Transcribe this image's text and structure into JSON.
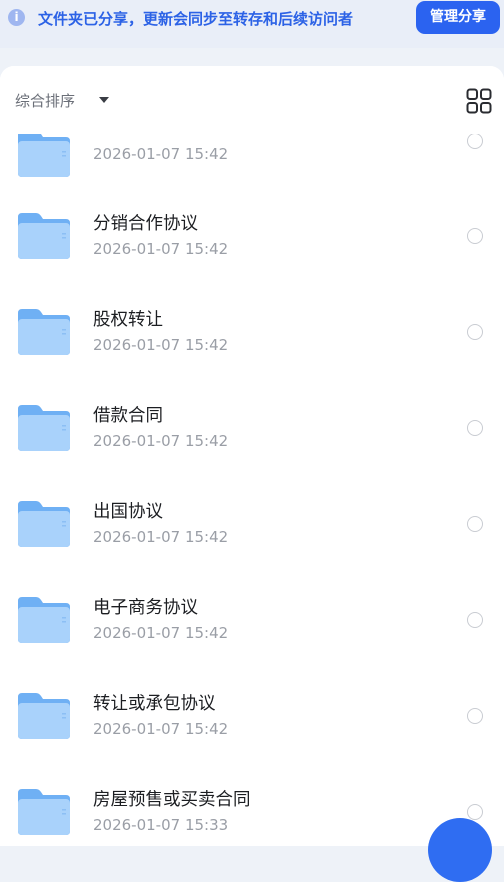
{
  "notice": {
    "icon": "info-icon",
    "text": "文件夹已分享，更新会同步至转存和后续访问者",
    "button": "管理分享"
  },
  "sort": {
    "label": "综合排序",
    "caret_icon": "caret-down-icon",
    "view_icon": "grid-view-icon"
  },
  "items": [
    {
      "name": "",
      "date": "2026-01-07 15:42"
    },
    {
      "name": "分销合作协议",
      "date": "2026-01-07 15:42"
    },
    {
      "name": "股权转让",
      "date": "2026-01-07 15:42"
    },
    {
      "name": "借款合同",
      "date": "2026-01-07 15:42"
    },
    {
      "name": "出国协议",
      "date": "2026-01-07 15:42"
    },
    {
      "name": "电子商务协议",
      "date": "2026-01-07 15:42"
    },
    {
      "name": "转让或承包协议",
      "date": "2026-01-07 15:42"
    },
    {
      "name": "房屋预售或买卖合同",
      "date": "2026-01-07 15:33"
    }
  ],
  "colors": {
    "accent": "#2b63f0",
    "notice_text": "#2c62e6",
    "folder_light": "#a9d2fb",
    "folder_dark": "#6fb0f4"
  }
}
